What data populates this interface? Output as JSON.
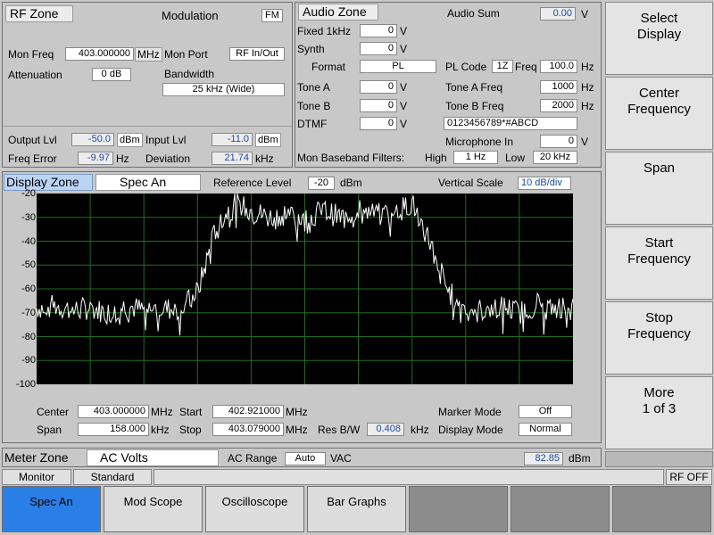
{
  "rf_zone": {
    "title": "RF Zone",
    "modulation_label": "Modulation",
    "modulation_value": "FM",
    "mon_freq_label": "Mon Freq",
    "mon_freq_value": "403.000000",
    "mon_freq_unit": "MHz",
    "mon_port_label": "Mon Port",
    "mon_port_value": "RF In/Out",
    "attenuation_label": "Attenuation",
    "attenuation_value": "0 dB",
    "bandwidth_label": "Bandwidth",
    "bandwidth_value": "25 kHz (Wide)",
    "output_lvl_label": "Output Lvl",
    "output_lvl_value": "-50.0",
    "output_lvl_unit": "dBm",
    "input_lvl_label": "Input Lvl",
    "input_lvl_value": "-11.0",
    "input_lvl_unit": "dBm",
    "freq_error_label": "Freq Error",
    "freq_error_value": "-9.97",
    "freq_error_unit": "Hz",
    "deviation_label": "Deviation",
    "deviation_value": "21.74",
    "deviation_unit": "kHz"
  },
  "audio_zone": {
    "title": "Audio Zone",
    "audio_sum_label": "Audio Sum",
    "audio_sum_value": "0.00",
    "audio_sum_unit": "V",
    "fixed_label": "Fixed 1kHz",
    "fixed_value": "0",
    "fixed_unit": "V",
    "synth_label": "Synth",
    "synth_value": "0",
    "synth_unit": "V",
    "format_label": "Format",
    "format_value": "PL",
    "pl_code_label": "PL Code",
    "pl_code_value": "1Z",
    "freq_label": "Freq",
    "freq_value": "100.0",
    "freq_unit": "Hz",
    "tone_a_label": "Tone A",
    "tone_a_value": "0",
    "tone_a_unit": "V",
    "tone_a_freq_label": "Tone A Freq",
    "tone_a_freq_value": "1000",
    "tone_a_freq_unit": "Hz",
    "tone_b_label": "Tone B",
    "tone_b_value": "0",
    "tone_b_unit": "V",
    "tone_b_freq_label": "Tone B Freq",
    "tone_b_freq_value": "2000",
    "tone_b_freq_unit": "Hz",
    "dtmf_label": "DTMF",
    "dtmf_value": "0",
    "dtmf_unit": "V",
    "dtmf_string": "0123456789*#ABCD",
    "mic_label": "Microphone In",
    "mic_value": "0",
    "mic_unit": "V",
    "mbf_label": "Mon Baseband Filters:",
    "high_label": "High",
    "high_value": "1 Hz",
    "low_label": "Low",
    "low_value": "20 kHz"
  },
  "display_zone": {
    "title": "Display Zone",
    "mode_value": "Spec An",
    "ref_level_label": "Reference Level",
    "ref_level_value": "-20",
    "ref_level_unit": "dBm",
    "vscale_label": "Vertical Scale",
    "vscale_value": "10 dB/div",
    "center_label": "Center",
    "center_value": "403.000000",
    "center_unit": "MHz",
    "start_label": "Start",
    "start_value": "402.921000",
    "start_unit": "MHz",
    "span_label": "Span",
    "span_value": "158.000",
    "span_unit": "kHz",
    "stop_label": "Stop",
    "stop_value": "403.079000",
    "stop_unit": "MHz",
    "resbw_label": "Res B/W",
    "resbw_value": "0.408",
    "resbw_unit": "kHz",
    "marker_mode_label": "Marker Mode",
    "marker_mode_value": "Off",
    "display_mode_label": "Display Mode",
    "display_mode_value": "Normal"
  },
  "chart_data": {
    "type": "line",
    "x_range": [
      402.921,
      403.079
    ],
    "ylim": [
      -100,
      -20
    ],
    "y_ticks": [
      "-20",
      "-30",
      "-40",
      "-50",
      "-60",
      "-70",
      "-80",
      "-90",
      "-100"
    ],
    "grid": true,
    "colors": {
      "background": "#000000",
      "grid": "#1e6e1e",
      "trace": "#ffffff"
    },
    "x": [
      402.921,
      402.9263,
      402.9316,
      402.9368,
      402.9421,
      402.9474,
      402.9527,
      402.9579,
      402.9632,
      402.9685,
      402.9737,
      402.979,
      402.9843,
      402.9895,
      402.9948,
      403.0,
      403.0053,
      403.0105,
      403.0158,
      403.0211,
      403.0263,
      403.0316,
      403.0369,
      403.0422,
      403.0474,
      403.0527,
      403.058,
      403.0632,
      403.0685,
      403.0738,
      403.079
    ],
    "values": [
      -68,
      -67,
      -69,
      -68,
      -70,
      -67,
      -69,
      -68,
      -69,
      -61,
      -35,
      -24,
      -27,
      -30,
      -28,
      -31,
      -27,
      -30,
      -26,
      -29,
      -28,
      -24,
      -40,
      -61,
      -68,
      -69,
      -67,
      -70,
      -66,
      -69,
      -64
    ]
  },
  "meter_zone": {
    "title": "Meter Zone",
    "mode_value": "AC Volts",
    "ac_range_label": "AC Range",
    "ac_range_value": "Auto",
    "ac_range_unit": "VAC",
    "reading_value": "82.85",
    "reading_unit": "dBm"
  },
  "status_bar": {
    "monitor": "Monitor",
    "standard": "Standard",
    "rf_off": "RF OFF"
  },
  "softkeys": [
    {
      "line1": "Select",
      "line2": "Display"
    },
    {
      "line1": "Center",
      "line2": "Frequency"
    },
    {
      "line1": "Span",
      "line2": ""
    },
    {
      "line1": "Start",
      "line2": "Frequency"
    },
    {
      "line1": "Stop",
      "line2": "Frequency"
    },
    {
      "line1": "More",
      "line2": "1 of 3"
    }
  ],
  "tabs": [
    "Spec An",
    "Mod Scope",
    "Oscilloscope",
    "Bar Graphs"
  ]
}
